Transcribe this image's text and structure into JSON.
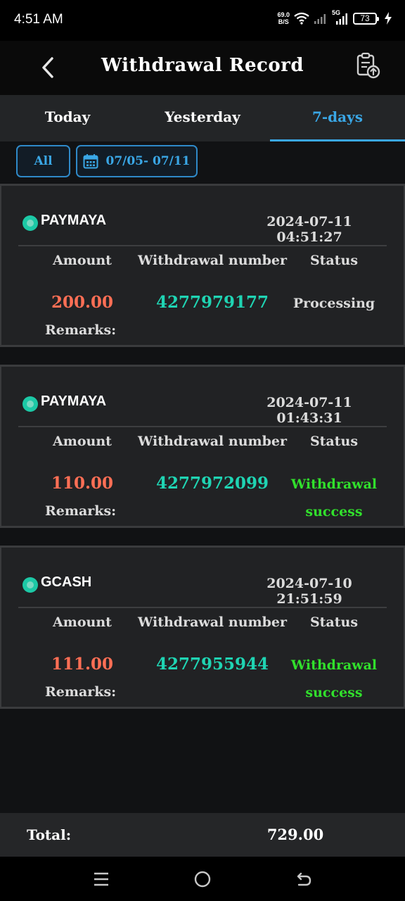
{
  "status_bar": {
    "time": "4:51 AM",
    "net_speed_value": "69.0",
    "net_speed_unit": "B/S",
    "network_type": "5G",
    "battery": "73",
    "icons": [
      "wifi-icon",
      "signal-icon",
      "signal-5g-icon",
      "battery-icon",
      "charging-icon"
    ]
  },
  "header": {
    "title": "Withdrawal Record",
    "back_icon": "chevron-left-icon",
    "action_icon": "clipboard-upload-icon"
  },
  "tabs": [
    {
      "label": "Today",
      "active": false
    },
    {
      "label": "Yesterday",
      "active": false
    },
    {
      "label": "7-days",
      "active": true
    }
  ],
  "filters": {
    "type_label": "All",
    "date_range": "07/05- 07/11",
    "date_icon": "calendar-icon"
  },
  "labels": {
    "amount": "Amount",
    "withdrawal_number": "Withdrawal number",
    "status": "Status",
    "remarks": "Remarks:"
  },
  "records": [
    {
      "method": "PAYMAYA",
      "datetime": "2024-07-11 04:51:27",
      "amount": "200.00",
      "number": "4277979177",
      "status_line1": "Processing",
      "status_line2": "",
      "status_type": "processing",
      "remarks": ""
    },
    {
      "method": "PAYMAYA",
      "datetime": "2024-07-11 01:43:31",
      "amount": "110.00",
      "number": "4277972099",
      "status_line1": "Withdrawal",
      "status_line2": "success",
      "status_type": "success",
      "remarks": ""
    },
    {
      "method": "GCASH",
      "datetime": "2024-07-10 21:51:59",
      "amount": "111.00",
      "number": "4277955944",
      "status_line1": "Withdrawal",
      "status_line2": "success",
      "status_type": "success",
      "remarks": ""
    }
  ],
  "total": {
    "label": "Total:",
    "value": "729.00"
  },
  "nav_bar": {
    "icons": [
      "menu-icon",
      "home-icon",
      "back-icon"
    ]
  },
  "colors": {
    "accent": "#3aa7e6",
    "amount": "#ff6f55",
    "number": "#1fd4b3",
    "success": "#31e02c",
    "card_bg": "#212224",
    "page_bg": "#111214"
  }
}
